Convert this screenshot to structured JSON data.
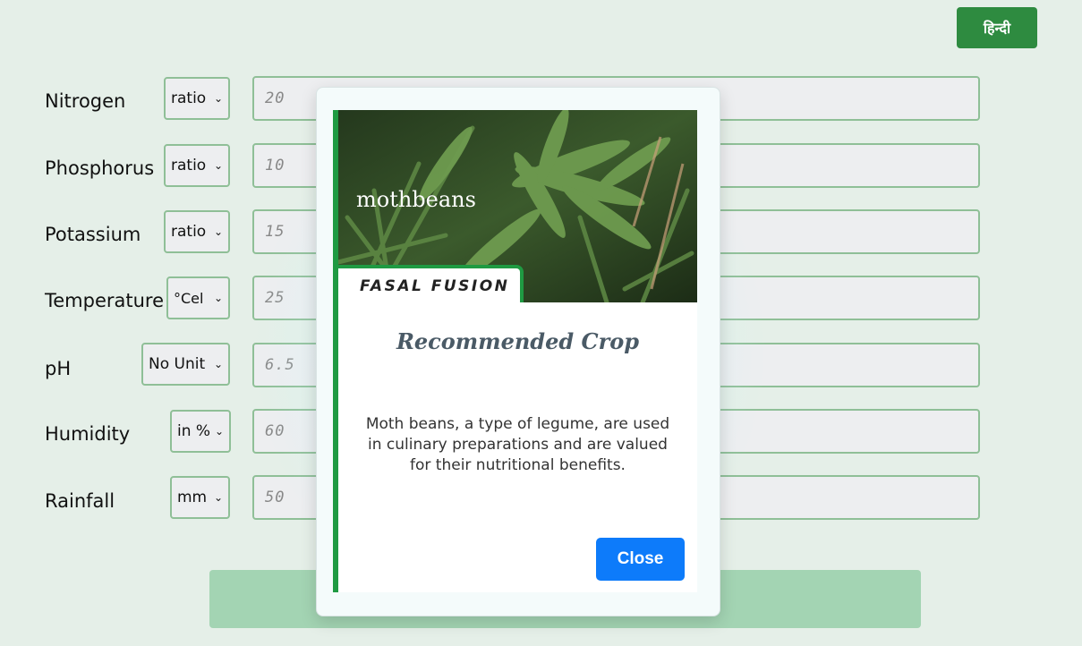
{
  "header": {
    "language_button": "हिन्दी"
  },
  "form": {
    "fields": [
      {
        "label": "Nitrogen",
        "unit": "ratio",
        "value": "20"
      },
      {
        "label": "Phosphorus",
        "unit": "ratio",
        "value": "10"
      },
      {
        "label": "Potassium",
        "unit": "ratio",
        "value": "15"
      },
      {
        "label": "Temperature",
        "unit": "°Cel",
        "value": "25"
      },
      {
        "label": "pH",
        "unit": "No Unit",
        "value": "6.5"
      },
      {
        "label": "Humidity",
        "unit": "in %",
        "value": "60"
      },
      {
        "label": "Rainfall",
        "unit": "mm",
        "value": "50"
      }
    ]
  },
  "modal": {
    "crop_name": "mothbeans",
    "brand": "FASAL FUSION",
    "title": "Recommended Crop",
    "description": "Moth beans, a type of legume, are used in culinary preparations and are valued for their nutritional benefits.",
    "close_label": "Close"
  },
  "colors": {
    "accent_green": "#2e8b40",
    "card_border": "#1f9a42",
    "close_blue": "#0d7bfa",
    "submit_green": "#a3d4b3"
  }
}
